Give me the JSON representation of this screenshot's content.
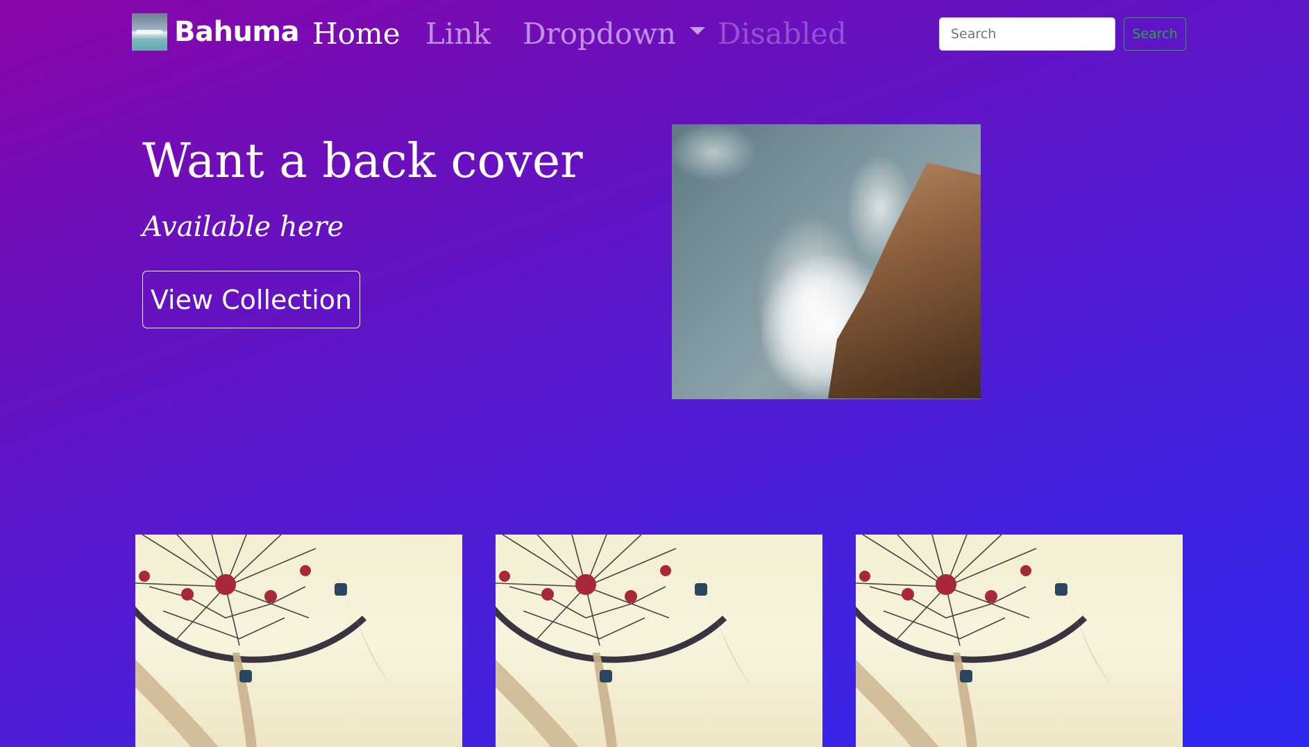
{
  "nav": {
    "brand": "Bahuma",
    "links": [
      {
        "label": "Home",
        "state": "active"
      },
      {
        "label": "Link",
        "state": "normal"
      },
      {
        "label": "Dropdown",
        "state": "normal"
      },
      {
        "label": "Disabled",
        "state": "disabled"
      }
    ],
    "search_placeholder": "Search",
    "search_button": "Search"
  },
  "hero": {
    "title": "Want a back cover",
    "subtitle": "Available here",
    "button": "View Collection"
  },
  "cards": [
    {
      "image": "dreamcatcher"
    },
    {
      "image": "dreamcatcher"
    },
    {
      "image": "dreamcatcher"
    }
  ],
  "colors": {
    "gradient_start": "#8a06a8",
    "gradient_end": "#2f28f0",
    "search_button_accent": "#28a745"
  }
}
